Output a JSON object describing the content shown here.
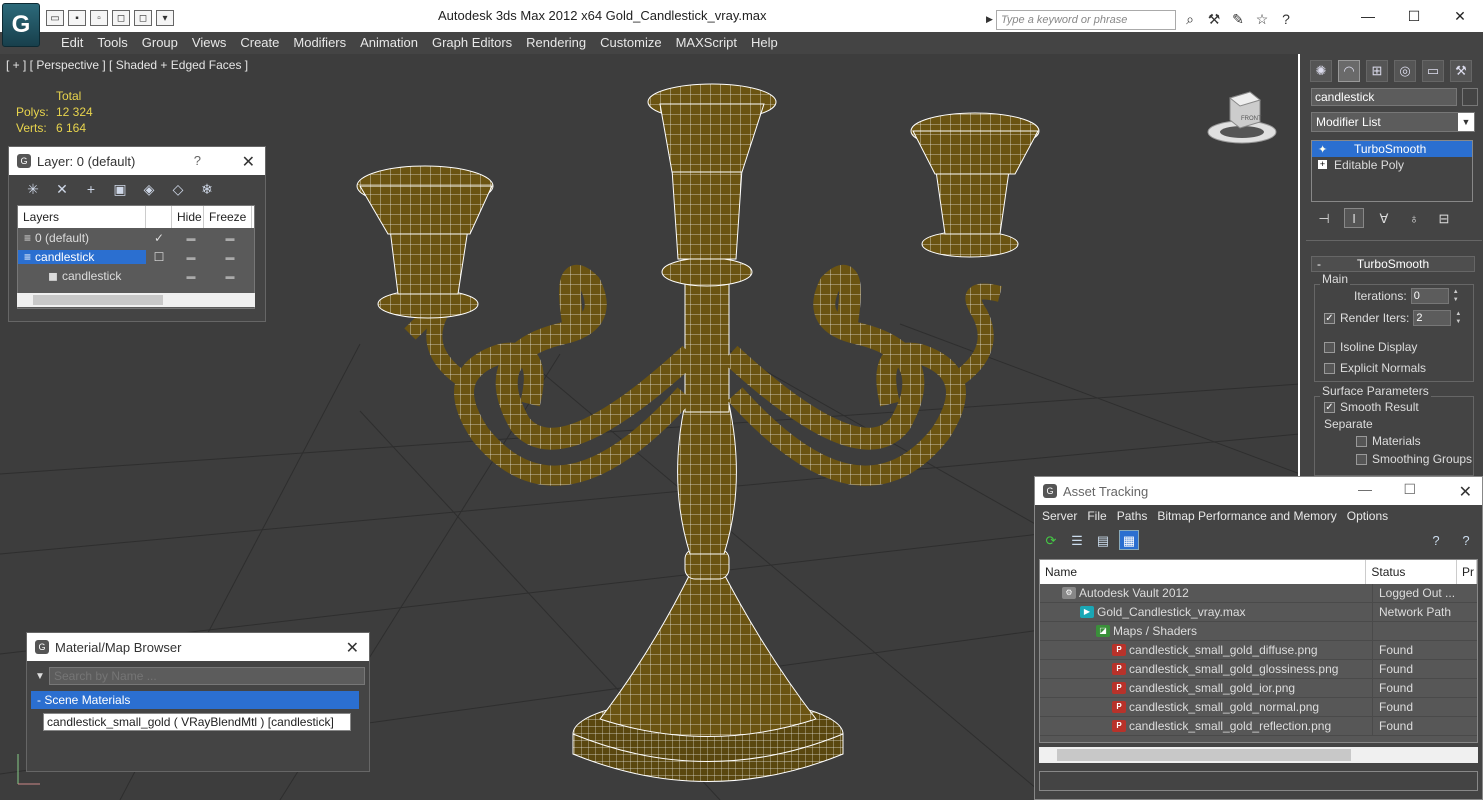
{
  "titlebar": {
    "title": "Autodesk 3ds Max  2012 x64       Gold_Candlestick_vray.max",
    "search_placeholder": "Type a keyword or phrase"
  },
  "menu": [
    "Edit",
    "Tools",
    "Group",
    "Views",
    "Create",
    "Modifiers",
    "Animation",
    "Graph Editors",
    "Rendering",
    "Customize",
    "MAXScript",
    "Help"
  ],
  "viewport": {
    "label": "[ + ] [ Perspective ] [ Shaded + Edged Faces ]",
    "stats_header": "Total",
    "polys_label": "Polys:",
    "polys_value": "12 324",
    "verts_label": "Verts:",
    "verts_value": "6 164",
    "viewcube_face": "FRONT"
  },
  "layer_dialog": {
    "title": "Layer: 0 (default)",
    "help": "?",
    "columns": [
      "Layers",
      "",
      "Hide",
      "Freeze"
    ],
    "rows": [
      {
        "name": "0 (default)",
        "current": "✓"
      },
      {
        "name": "candlestick"
      },
      {
        "name": "candlestick"
      }
    ]
  },
  "material_browser": {
    "title": "Material/Map Browser",
    "search_placeholder": "Search by Name ...",
    "group": "- Scene Materials",
    "item": "candlestick_small_gold ( VRayBlendMtl ) [candlestick]"
  },
  "command_panel": {
    "object_name": "candlestick",
    "modifier_list": "Modifier List",
    "stack": [
      "TurboSmooth",
      "Editable Poly"
    ],
    "rollout_title": "TurboSmooth",
    "rollout_minus": "-",
    "main_group": "Main",
    "iterations_label": "Iterations:",
    "iterations_value": "0",
    "render_iters_label": "Render Iters:",
    "render_iters_value": "2",
    "isoline_label": "Isoline Display",
    "explicit_label": "Explicit Normals",
    "surface_group": "Surface Parameters",
    "smooth_label": "Smooth Result",
    "separate_label": "Separate",
    "materials_label": "Materials",
    "smoothing_label": "Smoothing Groups"
  },
  "asset_tracking": {
    "title": "Asset Tracking",
    "menu": [
      "Server",
      "File",
      "Paths",
      "Bitmap Performance and Memory",
      "Options"
    ],
    "columns": [
      "Name",
      "Status",
      "Pr"
    ],
    "rows": [
      {
        "name": "Autodesk Vault 2012",
        "status": "Logged Out ...",
        "icon": "vault"
      },
      {
        "name": "Gold_Candlestick_vray.max",
        "status": "Network Path",
        "icon": "max"
      },
      {
        "name": "Maps / Shaders",
        "status": "",
        "icon": "maps"
      },
      {
        "name": "candlestick_small_gold_diffuse.png",
        "status": "Found",
        "icon": "png"
      },
      {
        "name": "candlestick_small_gold_glossiness.png",
        "status": "Found",
        "icon": "png"
      },
      {
        "name": "candlestick_small_gold_ior.png",
        "status": "Found",
        "icon": "png"
      },
      {
        "name": "candlestick_small_gold_normal.png",
        "status": "Found",
        "icon": "png"
      },
      {
        "name": "candlestick_small_gold_reflection.png",
        "status": "Found",
        "icon": "png"
      }
    ]
  },
  "colors": {
    "accent": "#2b6fd0",
    "stats": "#e8d44d",
    "wire": "#ffffff",
    "gold": "#6b5412",
    "grid": "#2a2a2a"
  }
}
